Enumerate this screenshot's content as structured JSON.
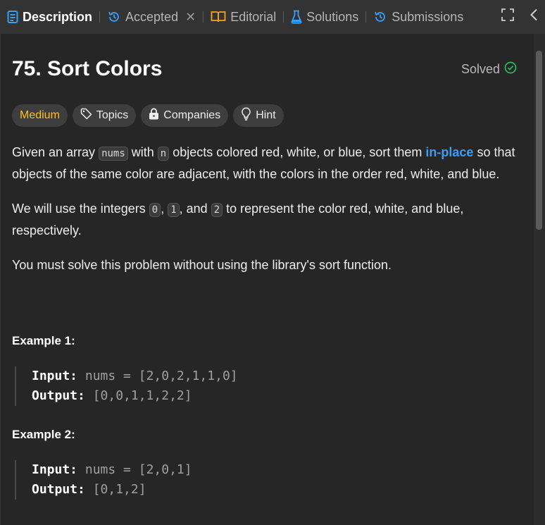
{
  "tabs": {
    "description": "Description",
    "accepted": "Accepted",
    "editorial": "Editorial",
    "solutions": "Solutions",
    "submissions": "Submissions"
  },
  "problem": {
    "title": "75. Sort Colors",
    "status": "Solved",
    "tags": {
      "difficulty": "Medium",
      "topics": "Topics",
      "companies": "Companies",
      "hint": "Hint"
    }
  },
  "description": {
    "p1": {
      "t1": "Given an array ",
      "c1": "nums",
      "t2": " with ",
      "c2": "n",
      "t3": " objects colored red, white, or blue, sort them ",
      "link": "in-place",
      "t4": " so that objects of the same color are adjacent, with the colors in the order red, white, and blue."
    },
    "p2": {
      "t1": "We will use the integers ",
      "c1": "0",
      "t2": ", ",
      "c2": "1",
      "t3": ", and ",
      "c3": "2",
      "t4": " to represent the color red, white, and blue, respectively."
    },
    "p3": "You must solve this problem without using the library's sort function."
  },
  "examples": [
    {
      "heading": "Example 1:",
      "input_label": "Input:",
      "input": "nums = [2,0,2,1,1,0]",
      "output_label": "Output:",
      "output": "[0,0,1,1,2,2]"
    },
    {
      "heading": "Example 2:",
      "input_label": "Input:",
      "input": "nums = [2,0,1]",
      "output_label": "Output:",
      "output": "[0,1,2]"
    }
  ],
  "colors": {
    "accent_blue": "#3b9ef5",
    "medium": "#ffc01e",
    "solved_green": "#2cbb5d"
  }
}
